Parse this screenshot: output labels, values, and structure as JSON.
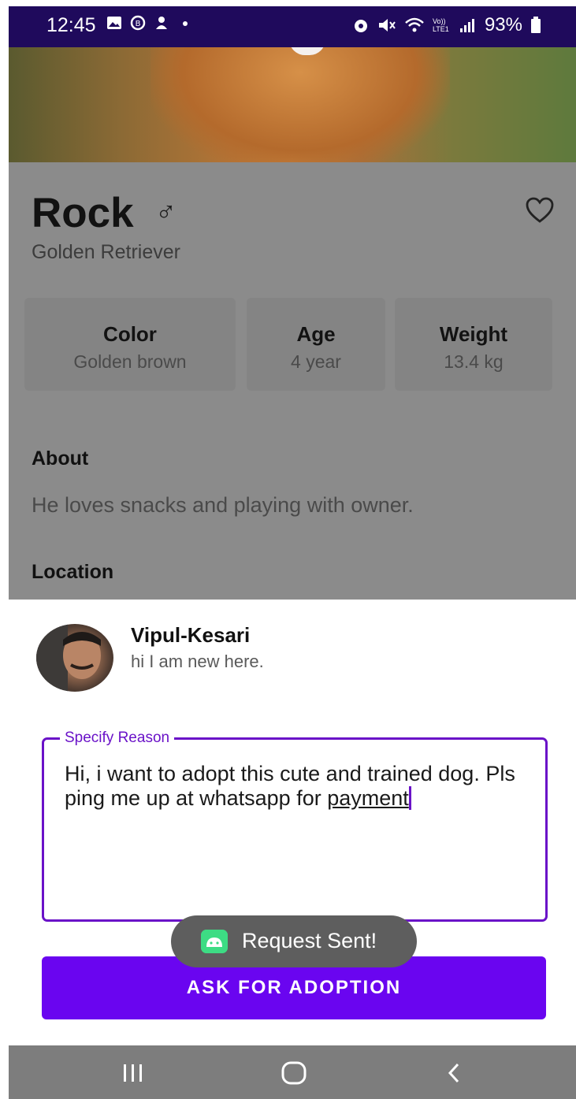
{
  "status_bar": {
    "time": "12:45",
    "signal_label": "Vo)) LTE1",
    "battery": "93%"
  },
  "pet": {
    "name": "Rock",
    "gender_symbol": "♂",
    "breed": "Golden Retriever",
    "stats": [
      {
        "title": "Color",
        "value": "Golden brown"
      },
      {
        "title": "Age",
        "value": "4 year"
      },
      {
        "title": "Weight",
        "value": "13.4 kg"
      }
    ],
    "about_heading": "About",
    "about_text": "He loves snacks and playing with owner.",
    "location_heading": "Location"
  },
  "sheet": {
    "user_name": "Vipul-Kesari",
    "user_status": "hi I am new here.",
    "reason_label": "Specify Reason",
    "reason_text_main": "Hi, i want to adopt this cute and trained dog. Pls ping me up at whatsapp for ",
    "reason_text_last": "payment",
    "toast": "Request Sent!",
    "button": "ASK FOR ADOPTION"
  },
  "colors": {
    "status_bar": "#1f0a5c",
    "accent": "#6a12c8",
    "button": "#6a05f0",
    "scrim": "#8b8b8b"
  },
  "icons": [
    "gallery-icon",
    "notification-icon",
    "alert-icon",
    "alarm-icon",
    "mute-icon",
    "wifi-icon",
    "signal-icon",
    "battery-icon",
    "heart-icon",
    "android-icon",
    "recent-apps-icon",
    "home-icon",
    "back-icon"
  ]
}
